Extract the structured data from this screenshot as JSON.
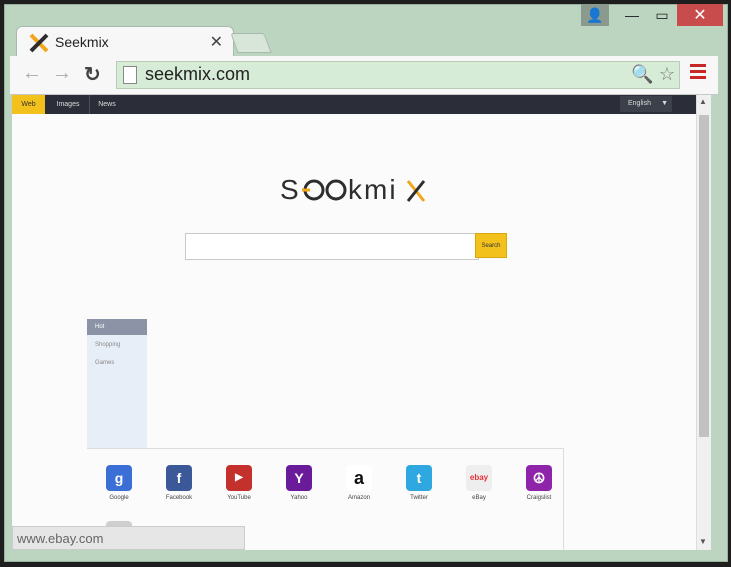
{
  "browser": {
    "tab_title": "Seekmix",
    "tab_icon": "seekmix-x-icon",
    "url": "seekmix.com",
    "status_url": "www.ebay.com"
  },
  "topbar": {
    "items": [
      "Web",
      "Images",
      "News"
    ],
    "language": "English"
  },
  "logo": "SEEKMIX",
  "search": {
    "button": "Search",
    "placeholder": ""
  },
  "sidebar": {
    "items": [
      "Hot",
      "Shopping",
      "Games"
    ]
  },
  "sites": [
    {
      "name": "Google",
      "icon": "google-icon",
      "color": "#3b6fd6",
      "glyph": "g"
    },
    {
      "name": "Facebook",
      "icon": "facebook-icon",
      "color": "#3b5998",
      "glyph": "f"
    },
    {
      "name": "YouTube",
      "icon": "youtube-icon",
      "color": "#c4302b",
      "glyph": "▶"
    },
    {
      "name": "Yahoo",
      "icon": "yahoo-icon",
      "color": "#6a1b9a",
      "glyph": "Y"
    },
    {
      "name": "Amazon",
      "icon": "amazon-icon",
      "color": "#ffffff",
      "glyph": "a"
    },
    {
      "name": "Twitter",
      "icon": "twitter-icon",
      "color": "#2fa8e1",
      "glyph": "t"
    },
    {
      "name": "eBay",
      "icon": "ebay-icon",
      "color": "#eeeeee",
      "glyph": "ebay"
    },
    {
      "name": "Craigslist",
      "icon": "craigslist-icon",
      "color": "#8e24aa",
      "glyph": "☮"
    }
  ]
}
